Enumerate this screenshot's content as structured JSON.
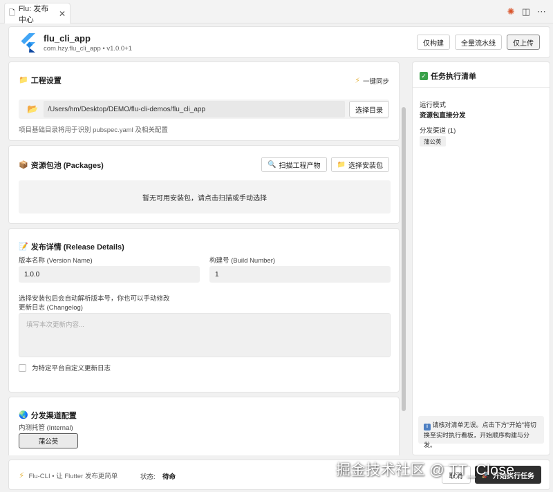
{
  "tab": {
    "title": "Flu: 发布中心",
    "close": "✕"
  },
  "header": {
    "app_name": "flu_cli_app",
    "app_meta": "com.hzy.flu_cli_app • v1.0.0+1",
    "buttons": {
      "build_only": "仅构建",
      "full_pipeline": "全量流水线",
      "upload_only": "仅上传"
    }
  },
  "project": {
    "title": "工程设置",
    "sync_label": "一键同步",
    "path": "/Users/hm/Desktop/DEMO/flu-cli-demos/flu_cli_app",
    "select_dir_label": "选择目录",
    "hint": "项目基础目录将用于识别 pubspec.yaml 及相关配置"
  },
  "packages": {
    "title": "资源包池 (Packages)",
    "scan_label": "扫描工程产物",
    "select_label": "选择安装包",
    "empty_text": "暂无可用安装包，请点击扫描或手动选择"
  },
  "release": {
    "title": "发布详情 (Release Details)",
    "version_name_label": "版本名称 (Version Name)",
    "version_name": "1.0.0",
    "build_number_label": "构建号 (Build Number)",
    "build_number": "1",
    "auto_hint": "选择安装包后会自动解析版本号，你也可以手动修改",
    "changelog_label": "更新日志 (Changelog)",
    "changelog_placeholder": "填写本次更新内容...",
    "custom_changelog_label": "为特定平台自定义更新日志"
  },
  "channels": {
    "title": "分发渠道配置",
    "internal_label": "内测托管 (Internal)",
    "chip": "蒲公英"
  },
  "checklist": {
    "title": "任务执行清单",
    "mode_label": "运行模式",
    "mode_value": "资源包直接分发",
    "channels_label": "分发渠道 (1)",
    "channel_chip": "蒲公英",
    "info_text": "请核对清单无误。点击下方\"开始\"将切换至实时执行看板，开始顺序构建与分发。"
  },
  "footer": {
    "brand": "Flu-CLI • 让 Flutter 发布更简单",
    "status_label": "状态:",
    "status_value": "待命",
    "cancel_label": "取消",
    "start_label": "开始执行任务"
  },
  "watermark": "掘金技术社区 @ TT_Close",
  "colors": {
    "flutter_blue": "#42a5f5",
    "flutter_dark": "#0d47a1",
    "accent_dark": "#2f2f2f",
    "check_green": "#3aa14a"
  }
}
